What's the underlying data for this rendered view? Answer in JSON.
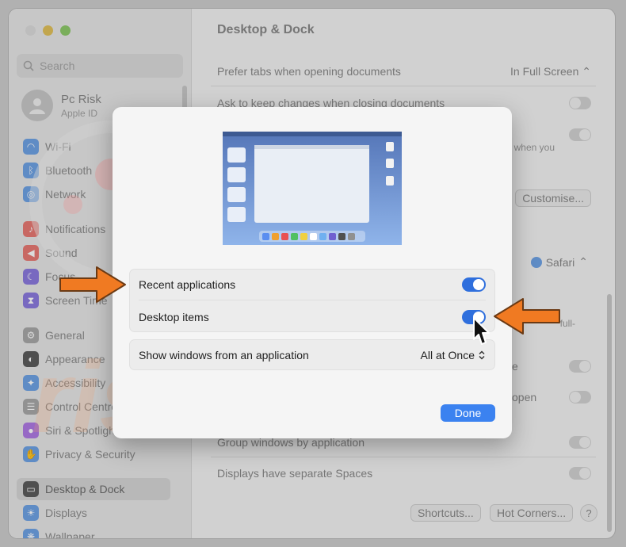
{
  "window": {
    "traffic_colors": [
      "#dcdcdc",
      "#e2c25b",
      "#8ecb6a"
    ]
  },
  "sidebar": {
    "search_placeholder": "Search",
    "user": {
      "name": "Pc Risk",
      "subtitle": "Apple ID"
    },
    "items": [
      {
        "label": "Wi-Fi",
        "icon": "wifi-icon",
        "color": "#6fa3e6"
      },
      {
        "label": "Bluetooth",
        "icon": "bluetooth-icon",
        "color": "#6fa3e6"
      },
      {
        "label": "Network",
        "icon": "globe-icon",
        "color": "#6fa3e6"
      },
      {
        "label": "Notifications",
        "icon": "bell-icon",
        "color": "#e97a74"
      },
      {
        "label": "Sound",
        "icon": "speaker-icon",
        "color": "#e97a74"
      },
      {
        "label": "Focus",
        "icon": "moon-icon",
        "color": "#8c7be0"
      },
      {
        "label": "Screen Time",
        "icon": "hourglass-icon",
        "color": "#8c7be0"
      },
      {
        "label": "General",
        "icon": "gear-icon",
        "color": "#a9a9a9"
      },
      {
        "label": "Appearance",
        "icon": "appearance-icon",
        "color": "#5c5c5c"
      },
      {
        "label": "Accessibility",
        "icon": "accessibility-icon",
        "color": "#6fa3e6"
      },
      {
        "label": "Control Centre",
        "icon": "control-centre-icon",
        "color": "#a9a9a9"
      },
      {
        "label": "Siri & Spotlight",
        "icon": "siri-icon",
        "color": "#b07be6"
      },
      {
        "label": "Privacy & Security",
        "icon": "hand-icon",
        "color": "#6fa3e6"
      },
      {
        "label": "Desktop & Dock",
        "icon": "dock-icon",
        "color": "#5c5c5c"
      },
      {
        "label": "Displays",
        "icon": "sun-icon",
        "color": "#6fa3e6"
      },
      {
        "label": "Wallpaper",
        "icon": "wallpaper-icon",
        "color": "#6fa3e6"
      }
    ]
  },
  "main": {
    "title": "Desktop & Dock",
    "rows": {
      "prefer_tabs": {
        "label": "Prefer tabs when opening documents",
        "value": "In Full Screen"
      },
      "ask_keep": {
        "label": "Ask to keep changes when closing documents"
      },
      "when_you": "when you",
      "customise": "Customise...",
      "browser": "Safari",
      "full": "full-",
      "e_text": "e",
      "open_text": "open",
      "group_windows": "Group windows by application",
      "separate_spaces": "Displays have separate Spaces"
    },
    "buttons": {
      "shortcuts": "Shortcuts...",
      "hot_corners": "Hot Corners...",
      "help": "?"
    }
  },
  "modal": {
    "options": [
      {
        "label": "Recent applications",
        "on": true
      },
      {
        "label": "Desktop items",
        "on": true
      }
    ],
    "show_windows": {
      "label": "Show windows from an application",
      "value": "All at Once"
    },
    "done_label": "Done"
  },
  "watermark": {
    "text": "risk.com",
    "logo": "PC"
  },
  "colors": {
    "accent": "#3b82f0",
    "arrow": "#f07a22"
  }
}
